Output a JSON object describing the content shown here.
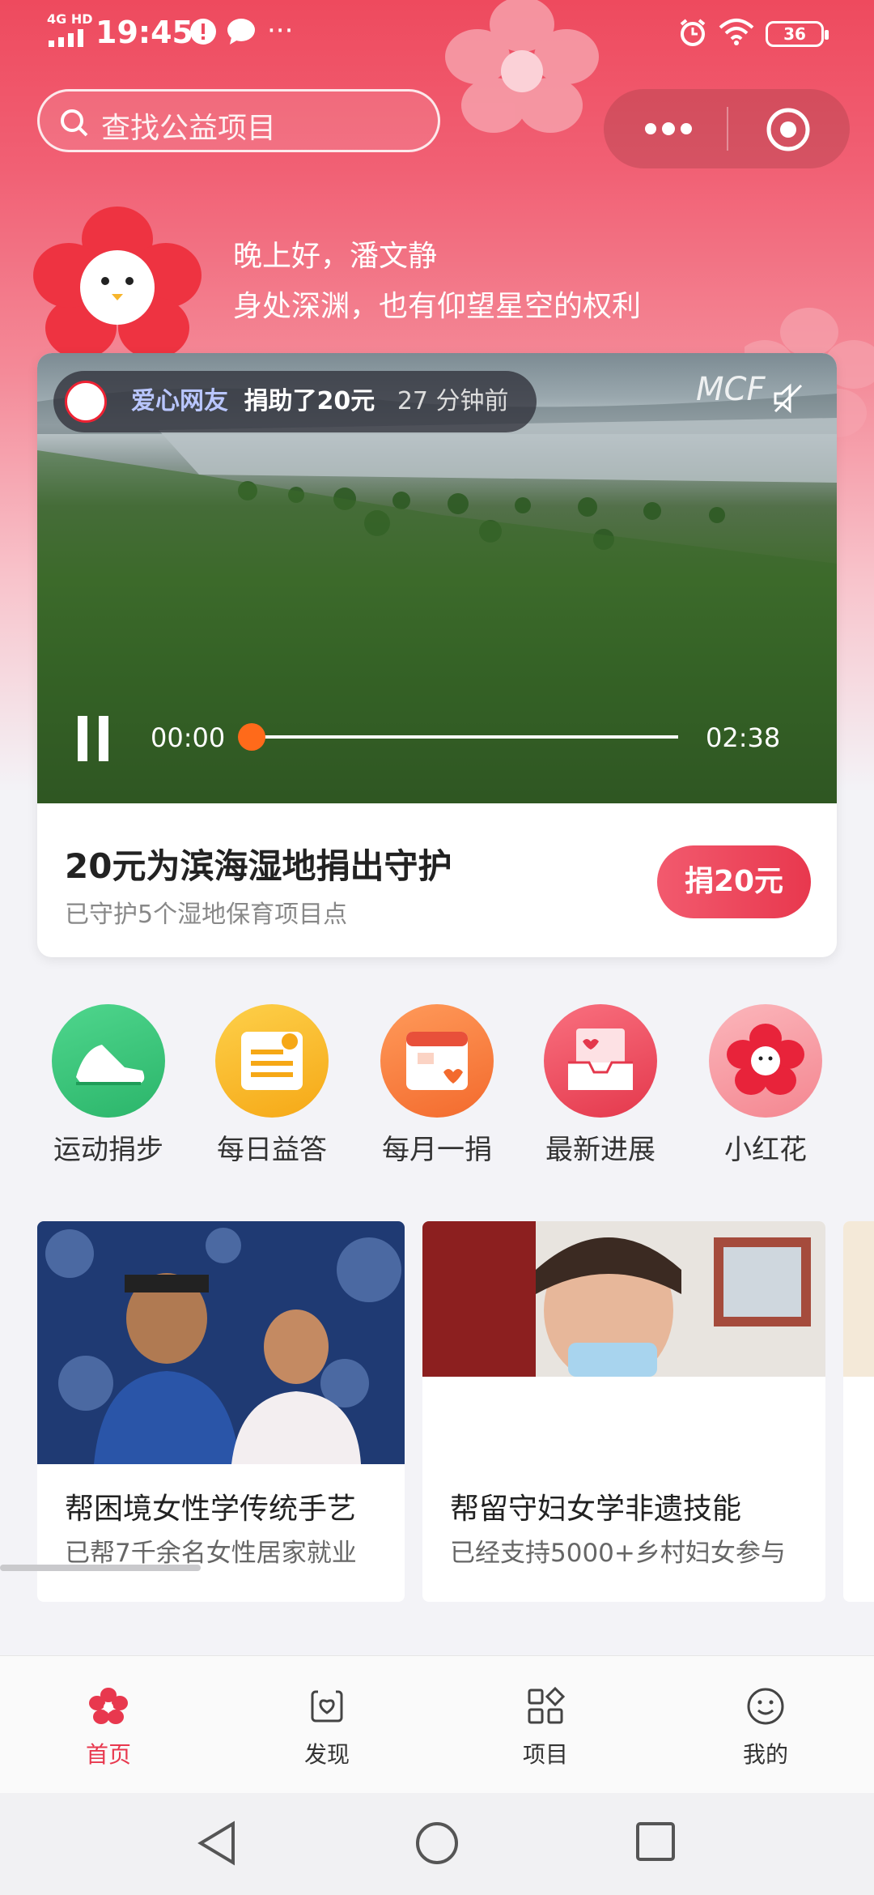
{
  "status_bar": {
    "network": "4G HD",
    "time": "19:45",
    "battery": "36"
  },
  "search": {
    "placeholder": "查找公益项目"
  },
  "greeting": {
    "line1": "晚上好，潘文静",
    "line2": "身处深渊，也有仰望星空的权利"
  },
  "video": {
    "donor_name": "爱心网友",
    "donor_action": "捐助了20元",
    "donor_time": "27 分钟前",
    "brand": "MCF",
    "current_time": "00:00",
    "total_time": "02:38",
    "progress": 0.0,
    "title": "20元为滨海湿地捐出守护",
    "subtitle": "已守护5个湿地保育项目点",
    "donate_button": "捐20元"
  },
  "shortcuts": [
    {
      "label": "运动捐步",
      "icon": "sneaker-icon",
      "color": "#35c27a"
    },
    {
      "label": "每日益答",
      "icon": "quiz-card-icon",
      "color": "#f9b92b"
    },
    {
      "label": "每月一捐",
      "icon": "calendar-heart-icon",
      "color": "#f7773f"
    },
    {
      "label": "最新进展",
      "icon": "inbox-heart-icon",
      "color": "#ee4a5e"
    },
    {
      "label": "小红花",
      "icon": "red-flower-icon",
      "color": "#f79a9f"
    }
  ],
  "projects": [
    {
      "title": "帮困境女性学传统手艺",
      "subtitle": "已帮7千余名女性居家就业"
    },
    {
      "title": "帮留守妇女学非遗技能",
      "subtitle": "已经支持5000+乡村妇女参与"
    }
  ],
  "tabs": [
    {
      "label": "首页",
      "icon": "home-flower-icon",
      "active": true
    },
    {
      "label": "发现",
      "icon": "discover-icon",
      "active": false
    },
    {
      "label": "项目",
      "icon": "projects-icon",
      "active": false
    },
    {
      "label": "我的",
      "icon": "profile-smile-icon",
      "active": false
    }
  ],
  "colors": {
    "accent": "#e8384e",
    "progress": "#ff6a1a"
  }
}
